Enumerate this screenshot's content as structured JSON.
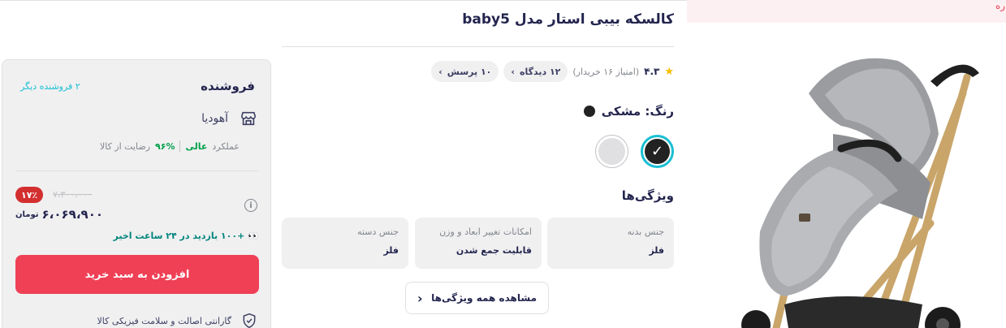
{
  "promo": {
    "text": "ره"
  },
  "product": {
    "title": "کالسکه بیبی استار مدل baby5",
    "rating": "۴.۳",
    "rating_count": "(امتیاز ۱۶ خریدار)",
    "reviews_chip": "۱۲ دیدگاه",
    "questions_chip": "۱۰ پرسش",
    "color_label": "رنگ: مشکی",
    "colors": [
      {
        "name": "black",
        "hex": "#222222",
        "selected": true
      },
      {
        "name": "gray",
        "hex": "#e0e0e2",
        "selected": false
      }
    ]
  },
  "features": {
    "title": "ویژگی‌ها",
    "items": [
      {
        "key": "جنس بدنه",
        "value": "فلز"
      },
      {
        "key": "امکانات تغییر ابعاد و وزن",
        "value": "قابلیت جمع شدن"
      },
      {
        "key": "جنس دسته",
        "value": "فلز"
      }
    ],
    "see_all": "مشاهده همه ویژگی‌ها"
  },
  "seller": {
    "heading": "فروشنده",
    "other_sellers": "۲ فروشنده دیگر",
    "name": "آهودیا",
    "satisfaction": "۹۶%",
    "satisfaction_label": "رضایت از کالا",
    "performance_label": "عملکرد",
    "performance_value": "عالی"
  },
  "price": {
    "discount": "۱۷٪",
    "old_price": "۷،۳۰۰،۰۰۰",
    "current": "۶،۰۶۹،۹۰۰",
    "currency": "تومان",
    "visits": "+۱۰۰ بازدید در ۲۴ ساعت اخیر",
    "visits_emoji": "👀",
    "add_to_cart": "افزودن به سبد خرید",
    "guarantee": "گارانتی اصالت و سلامت فیزیکی کالا"
  },
  "icons": {
    "star": "star-icon",
    "chevron": "chevron-left-icon",
    "store": "store-icon",
    "info": "info-icon",
    "shield": "shield-check-icon"
  },
  "colors": {
    "accent": "#19bfd3",
    "primary_button": "#ef4056",
    "discount": "#d32f2f",
    "success": "#00a049"
  }
}
